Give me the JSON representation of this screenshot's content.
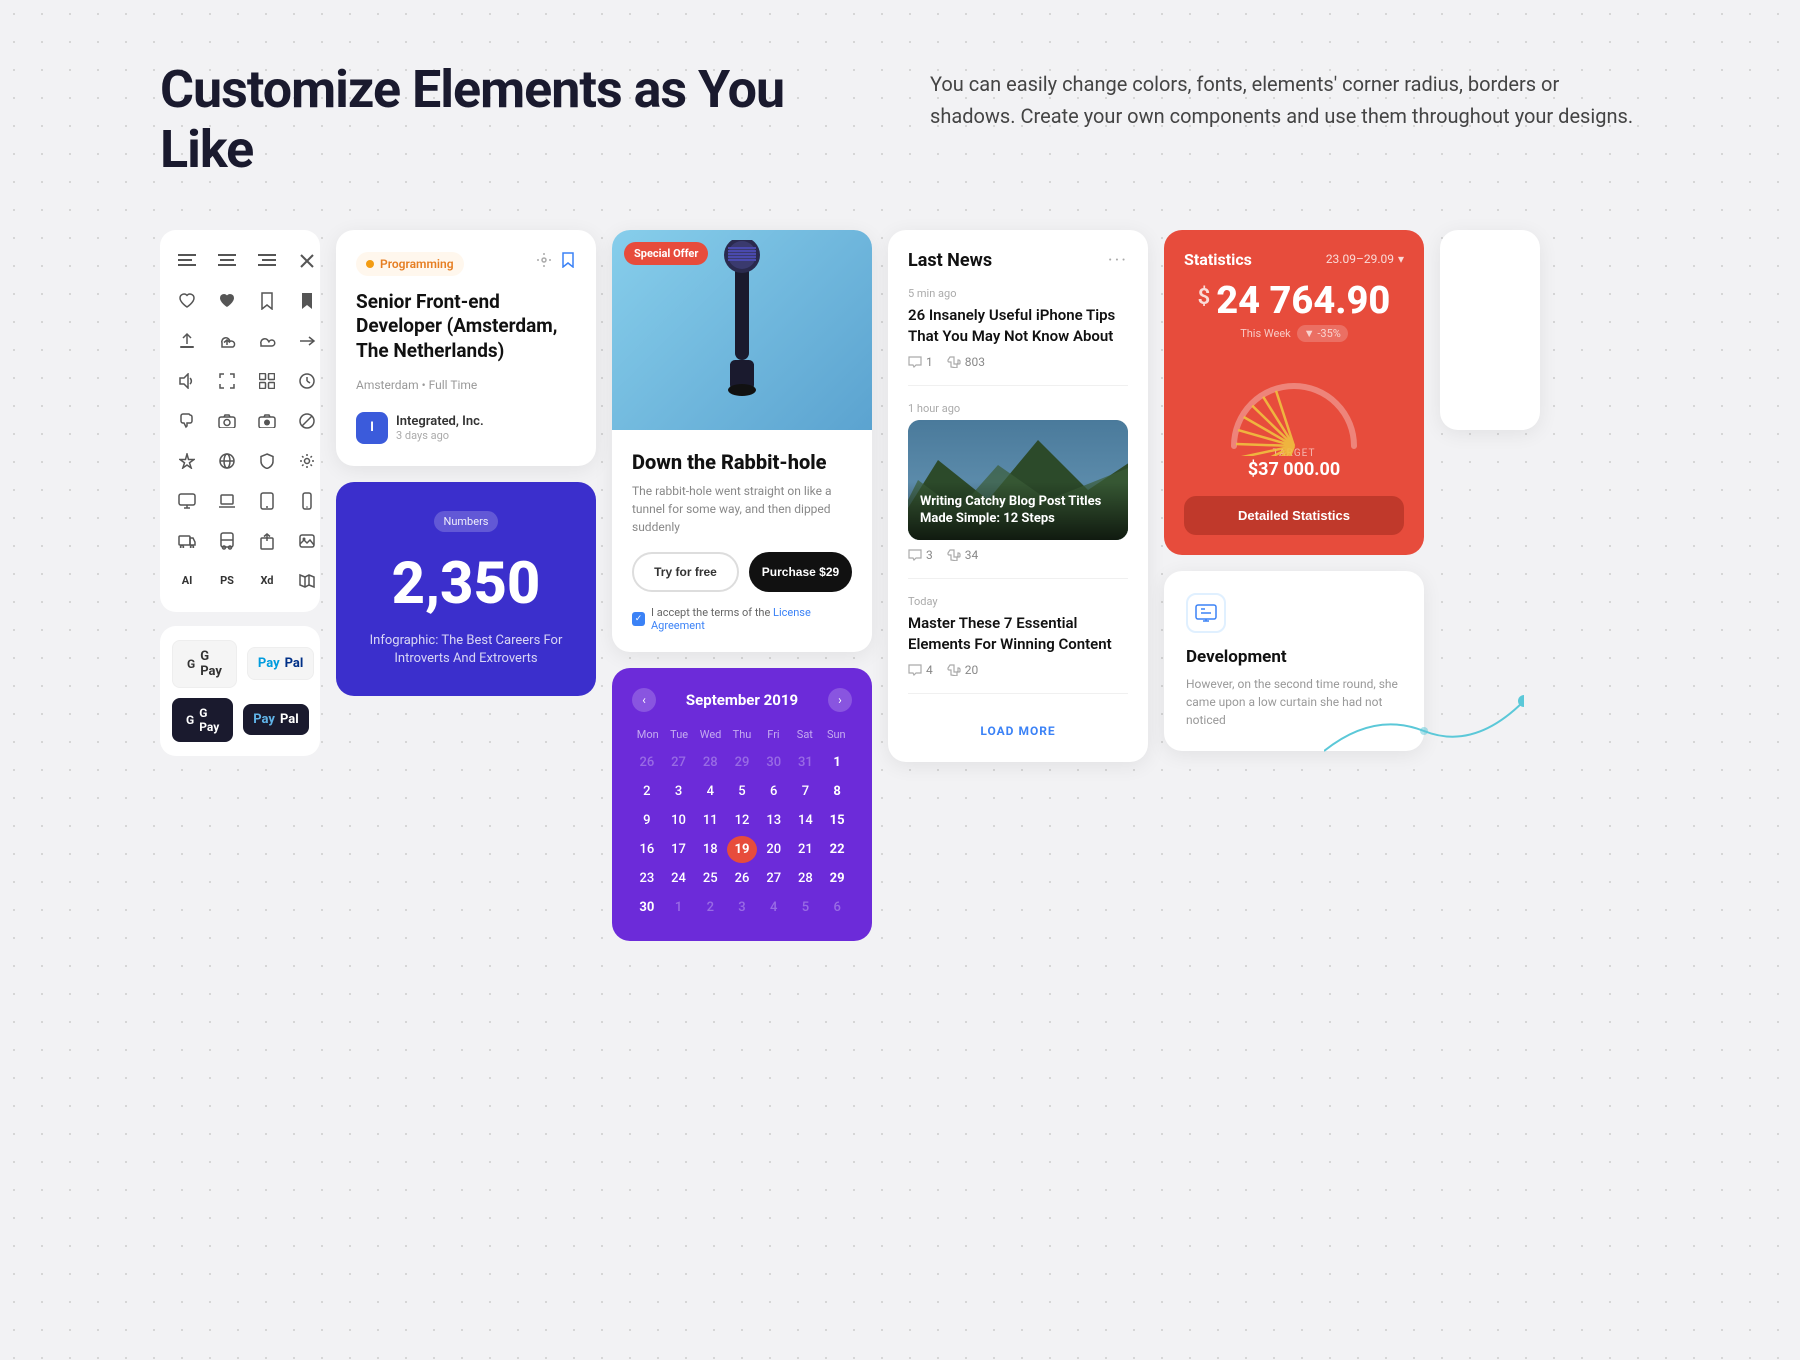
{
  "page": {
    "title": "Customize Elements as You Like",
    "description": "You can easily change colors, fonts, elements' corner radius, borders or shadows. Create your own components and use them throughout your designs."
  },
  "icons": {
    "align_left": "☰",
    "align_center": "≡",
    "align_right": "⋮",
    "close": "✕",
    "heart_outline": "♡",
    "heart_filled": "♥",
    "bookmark": "🔖",
    "bookmark_filled": "⊿",
    "upload": "↑",
    "cloud_upload": "☁",
    "cloud": "⛅",
    "arrow_right": "→",
    "volume": "🔊",
    "expand": "⊡",
    "settings": "⊞",
    "clock": "⏱",
    "thumb_down": "👎",
    "camera_1": "📷",
    "camera_2": "📸",
    "forbidden": "⊘",
    "sparkle": "✦",
    "globe": "🌐",
    "shield": "🛡",
    "monitor": "🖥",
    "desktop": "💻",
    "mobile": "📱",
    "truck": "🚚",
    "bus": "🚌",
    "upload2": "⬆",
    "image": "🖼",
    "ai": "AI",
    "ps": "PS",
    "xd": "Xd",
    "map": "🗺"
  },
  "job_card": {
    "tag": "Programming",
    "title": "Senior Front-end Developer (Amsterdam, The Netherlands)",
    "location": "Amsterdam",
    "job_type": "Full Time",
    "company": "Integrated, Inc.",
    "time_posted": "3 days ago"
  },
  "numbers_card": {
    "badge": "Numbers",
    "value": "2,350",
    "description": "Infographic: The Best Careers For Introverts And Extroverts"
  },
  "product_card": {
    "badge": "Special Offer",
    "title": "Down the Rabbit-hole",
    "description": "The rabbit-hole went straight on like a tunnel for some way, and then dipped suddenly",
    "btn_try": "Try for free",
    "btn_purchase": "Purchase $29",
    "terms": "I accept the terms of the",
    "terms_link": "License Agreement"
  },
  "calendar": {
    "title": "September 2019",
    "days_header": [
      "Mon",
      "Tue",
      "Wed",
      "Thu",
      "Fri",
      "Sat",
      "Sun"
    ],
    "weeks": [
      [
        "26",
        "27",
        "28",
        "29",
        "30",
        "31",
        "1"
      ],
      [
        "2",
        "3",
        "4",
        "5",
        "6",
        "7",
        "8"
      ],
      [
        "9",
        "10",
        "11",
        "12",
        "13",
        "14",
        "15"
      ],
      [
        "16",
        "17",
        "18",
        "19",
        "20",
        "21",
        "22"
      ],
      [
        "23",
        "24",
        "25",
        "26",
        "27",
        "28",
        "29"
      ],
      [
        "30",
        "1",
        "2",
        "3",
        "4",
        "5",
        "6"
      ]
    ],
    "today_index": [
      3,
      3
    ],
    "faded_first_row": [
      0,
      1,
      2,
      3,
      4,
      5
    ],
    "faded_last_row": [
      1,
      2,
      3,
      4,
      5,
      6
    ]
  },
  "news_card": {
    "title": "Last News",
    "items": [
      {
        "time_ago": "5 min ago",
        "headline": "26 Insanely Useful iPhone Tips That You May Not Know About",
        "comments": "1",
        "likes": "803",
        "type": "text"
      },
      {
        "time_ago": "1 hour ago",
        "headline": "Writing Catchy Blog Post Titles Made Simple: 12 Steps",
        "comments": "3",
        "likes": "34",
        "type": "image"
      },
      {
        "time_ago": "Today",
        "headline": "Master These 7 Essential Elements For Winning Content",
        "comments": "4",
        "likes": "20",
        "type": "text"
      }
    ],
    "load_more": "LOAD MORE"
  },
  "stats_card": {
    "title": "Statistics",
    "date_range": "23.09–29.09",
    "amount": "24 764.90",
    "this_week": "This Week",
    "change": "▼ -35%",
    "target_label": "TARGET",
    "target_amount": "$37 000.00",
    "btn_label": "Detailed Statistics"
  },
  "dev_card": {
    "title": "Development",
    "description": "However, on the second time round, she came upon a low curtain she had not noticed"
  },
  "payments": {
    "gpay_light": "G Pay",
    "paypal_light": "PayPal",
    "gpay_dark": "G Pay",
    "paypal_dark": "PayPal"
  },
  "colors": {
    "primary_blue": "#3b2fcc",
    "primary_red": "#e74c3c",
    "primary_purple": "#6c2bd9",
    "accent_blue": "#3b82f6",
    "text_dark": "#1a1a2e",
    "text_muted": "#888"
  }
}
